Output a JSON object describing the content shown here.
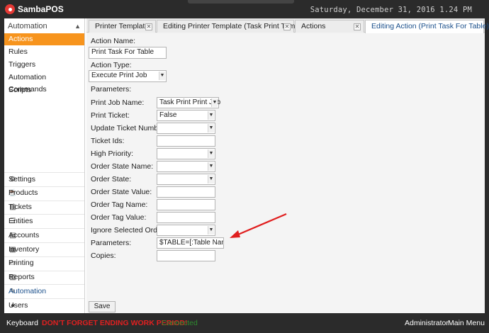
{
  "app": {
    "name": "SambaPOS",
    "datetime": "Saturday, December 31, 2016 1.24 PM"
  },
  "sidebar": {
    "header": "Automation",
    "sub_items": [
      {
        "label": "Actions",
        "active": true
      },
      {
        "label": "Rules"
      },
      {
        "label": "Triggers"
      },
      {
        "label": "Automation Commands"
      },
      {
        "label": "Scripts"
      }
    ],
    "nav_items": [
      {
        "label": "Settings",
        "icon": "gear-icon"
      },
      {
        "label": "Products",
        "icon": "coffee-cup-icon"
      },
      {
        "label": "Tickets",
        "icon": "tickets-icon"
      },
      {
        "label": "Entities",
        "icon": "list-icon"
      },
      {
        "label": "Accounts",
        "icon": "accounts-icon"
      },
      {
        "label": "Inventory",
        "icon": "inventory-icon"
      },
      {
        "label": "Printing",
        "icon": "document-icon"
      },
      {
        "label": "Reports",
        "icon": "reports-icon"
      },
      {
        "label": "Automation",
        "icon": "pencil-icon",
        "current": true
      },
      {
        "label": "Users",
        "icon": "user-icon"
      }
    ]
  },
  "tabs": [
    {
      "label": "Printer Templates"
    },
    {
      "label": "Editing Printer Template (Task Print Template)"
    },
    {
      "label": "Actions"
    },
    {
      "label": "Editing Action (Print Task For Table)",
      "active": true
    }
  ],
  "form": {
    "action_name_label": "Action Name:",
    "action_name_value": "Print Task For Table",
    "action_type_label": "Action Type:",
    "action_type_value": "Execute Print Job",
    "parameters_header": "Parameters:",
    "fields": [
      {
        "label": "Print Job Name:",
        "value": "Task Print Print Job",
        "kind": "combo"
      },
      {
        "label": "Print Ticket:",
        "value": "False",
        "kind": "combo"
      },
      {
        "label": "Update Ticket Number:",
        "value": "",
        "kind": "combo"
      },
      {
        "label": "Ticket Ids:",
        "value": "",
        "kind": "text"
      },
      {
        "label": "High Priority:",
        "value": "",
        "kind": "combo"
      },
      {
        "label": "Order State Name:",
        "value": "",
        "kind": "combo"
      },
      {
        "label": "Order State:",
        "value": "",
        "kind": "combo"
      },
      {
        "label": "Order State Value:",
        "value": "",
        "kind": "text"
      },
      {
        "label": "Order Tag Name:",
        "value": "",
        "kind": "text"
      },
      {
        "label": "Order Tag Value:",
        "value": "",
        "kind": "text"
      },
      {
        "label": "Ignore Selected Orders:",
        "value": "",
        "kind": "combo"
      },
      {
        "label": "Parameters:",
        "value": "$TABLE=[:Table Name]",
        "kind": "text"
      },
      {
        "label": "Copies:",
        "value": "",
        "kind": "text"
      }
    ],
    "save_label": "Save"
  },
  "annotation": {
    "color": "#e01e1e"
  },
  "footer": {
    "keyboard": "Keyboard",
    "warning": "DON'T FORGET ENDING WORK PERIOD!",
    "status": "Connected",
    "user": "Administrator",
    "main_menu": "Main Menu"
  },
  "colors": {
    "accent": "#f7941d",
    "background": "#2b2b2b",
    "link": "#1a4f8b",
    "warning": "#e02020",
    "connected": "#2e8b2e"
  }
}
